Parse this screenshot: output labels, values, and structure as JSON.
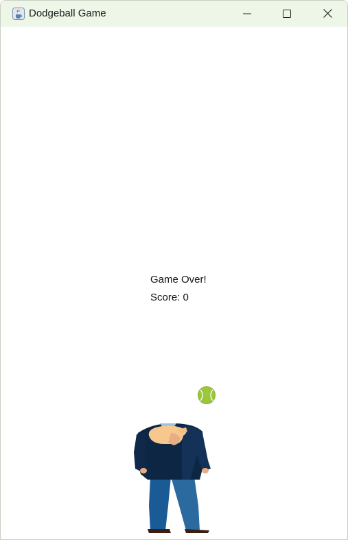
{
  "window": {
    "title": "Dodgeball Game",
    "icons": {
      "app": "java-cup-icon",
      "minimize": "minimize-icon",
      "maximize": "maximize-icon",
      "close": "close-icon"
    }
  },
  "game": {
    "status_text": "Game Over!",
    "score_label": "Score",
    "score_value": 0,
    "score_text": "Score: 0",
    "colors": {
      "ball": "#9cc63b",
      "jacket": "#0d2644",
      "pants": "#1b5b95",
      "hair": "#f6c88e",
      "shoes": "#3a1e16"
    }
  }
}
